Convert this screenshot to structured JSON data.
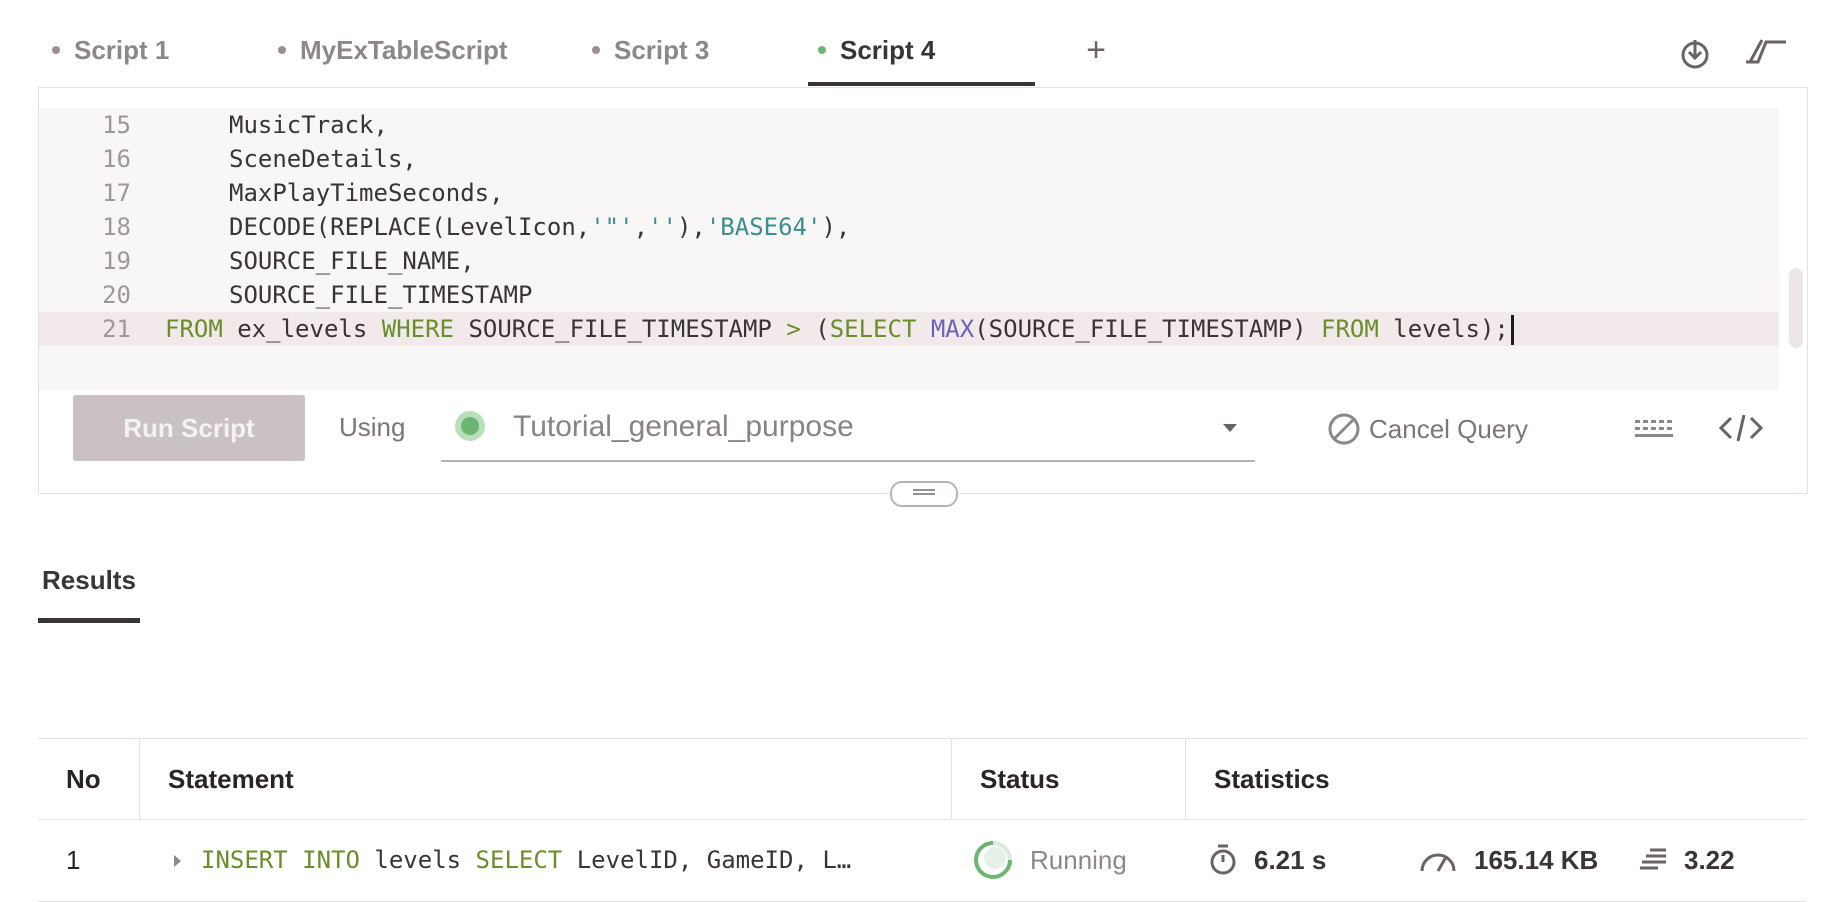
{
  "tabs": [
    {
      "label": "Script 1",
      "active": false
    },
    {
      "label": "MyExTableScript",
      "active": false
    },
    {
      "label": "Script 3",
      "active": false
    },
    {
      "label": "Script 4",
      "active": true
    }
  ],
  "header_icons": {
    "add": "+",
    "download": "download-icon",
    "connect": "connection-icon"
  },
  "editor": {
    "lines": [
      {
        "no": "15",
        "text": "MusicTrack,"
      },
      {
        "no": "16",
        "text": "SceneDetails,"
      },
      {
        "no": "17",
        "text": "MaxPlayTimeSeconds,"
      },
      {
        "no": "18",
        "text": "DECODE(REPLACE(LevelIcon,'\"','' ),'BASE64'),"
      },
      {
        "no": "19",
        "text": "SOURCE_FILE_NAME,"
      },
      {
        "no": "20",
        "text": "SOURCE_FILE_TIMESTAMP"
      },
      {
        "no": "21",
        "text": "FROM ex_levels WHERE SOURCE_FILE_TIMESTAMP > (SELECT MAX(SOURCE_FILE_TIMESTAMP) FROM levels);"
      }
    ],
    "line18": {
      "pre": "DECODE(REPLACE(LevelIcon,",
      "s1": "'\"'",
      "comma1": ",",
      "s2": "''",
      "mid": "),",
      "s3": "'BASE64'",
      "post": "),"
    },
    "line21": {
      "k1": "FROM",
      "t1": " ex_levels ",
      "k2": "WHERE",
      "t2": " SOURCE_FILE_TIMESTAMP ",
      "op": ">",
      "t3": " (",
      "k3": "SELECT",
      "sp": " ",
      "f1": "MAX",
      "t4": "(SOURCE_FILE_TIMESTAMP) ",
      "k4": "FROM",
      "t5": " levels);"
    }
  },
  "toolbar": {
    "run_label": "Run Script",
    "using_label": "Using",
    "database": "Tutorial_general_purpose",
    "cancel_label": "Cancel Query"
  },
  "results": {
    "tab_label": "Results",
    "columns": [
      "No",
      "Statement",
      "Status",
      "Statistics"
    ],
    "rows": [
      {
        "no": "1",
        "statement": {
          "k1": "INSERT",
          "k2": "INTO",
          "t1": " levels ",
          "k3": "SELECT",
          "t2": " LevelID, GameID, L…"
        },
        "status": "Running",
        "time": "6.21 s",
        "size": "165.14 KB",
        "rows": "3.22"
      }
    ]
  },
  "colors": {
    "accent_green": "#6db573",
    "keyword": "#6a8e2a",
    "function": "#6a63b5",
    "string": "#3a8f8f"
  }
}
